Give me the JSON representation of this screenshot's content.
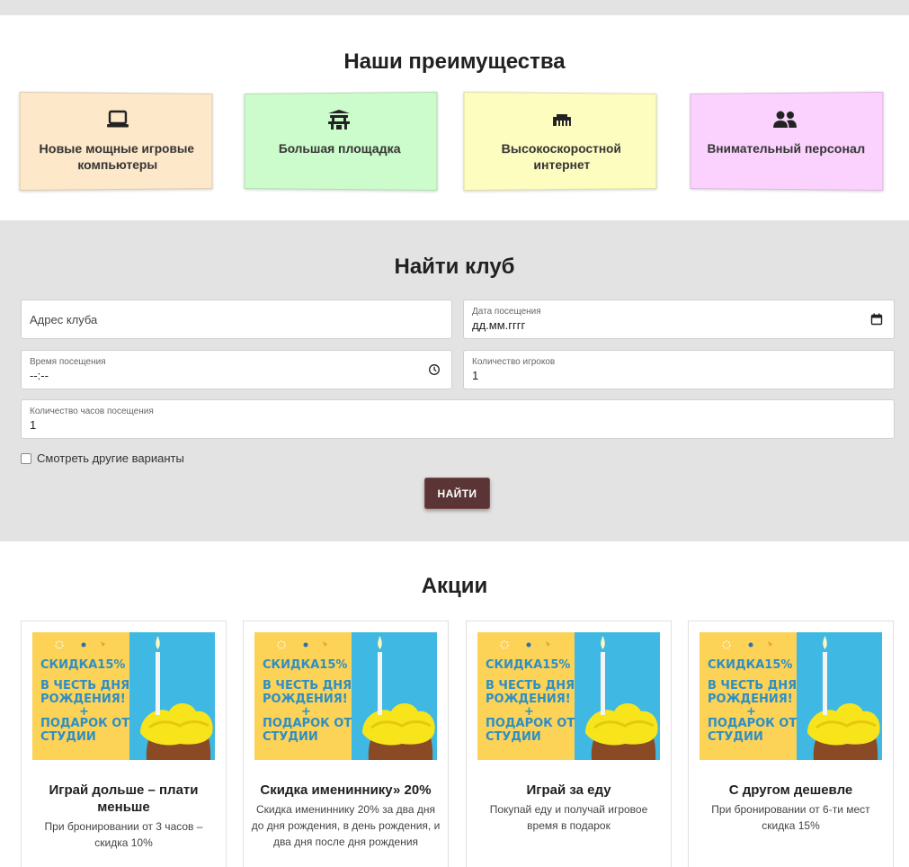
{
  "advantages": {
    "title": "Наши преимущества",
    "items": [
      {
        "label": "Новые мощные игровые компьютеры",
        "icon": "laptop-icon"
      },
      {
        "label": "Большая площадка",
        "icon": "pagoda-icon"
      },
      {
        "label": "Высокоскоростной интернет",
        "icon": "ethernet-icon"
      },
      {
        "label": "Внимательный персонал",
        "icon": "users-icon"
      }
    ]
  },
  "find": {
    "title": "Найти клуб",
    "address_placeholder": "Адрес клуба",
    "date_label": "Дата посещения",
    "date_value": "дд.мм.гггг",
    "time_label": "Время посещения",
    "time_value": "--:--",
    "players_label": "Количество игроков",
    "players_value": "1",
    "hours_label": "Количество часов посещения",
    "hours_value": "1",
    "other_options_label": "Смотреть другие варианты",
    "button_label": "НАЙТИ",
    "button_color": "#5b3535"
  },
  "promos": {
    "title": "Акции",
    "banner": {
      "line1": "СКИДКА15%",
      "line2": "В ЧЕСТЬ ДНЯ",
      "line3": "РОЖДЕНИЯ!",
      "line4": "+",
      "line5": "ПОДАРОК ОТ",
      "line6": "СТУДИИ"
    },
    "items": [
      {
        "title": "Играй дольше – плати меньше",
        "desc": "При бронировании от 3 часов – скидка 10%"
      },
      {
        "title": "Скидка имениннику» 20%",
        "desc": "Скидка имениннику 20% за два дня до дня рождения, в день рождения, и два дня после дня рождения"
      },
      {
        "title": "Играй за еду",
        "desc": "Покупай еду и получай игровое время в подарок"
      },
      {
        "title": "С другом дешевле",
        "desc": "При бронировании от 6-ти мест скидка 15%"
      }
    ]
  }
}
